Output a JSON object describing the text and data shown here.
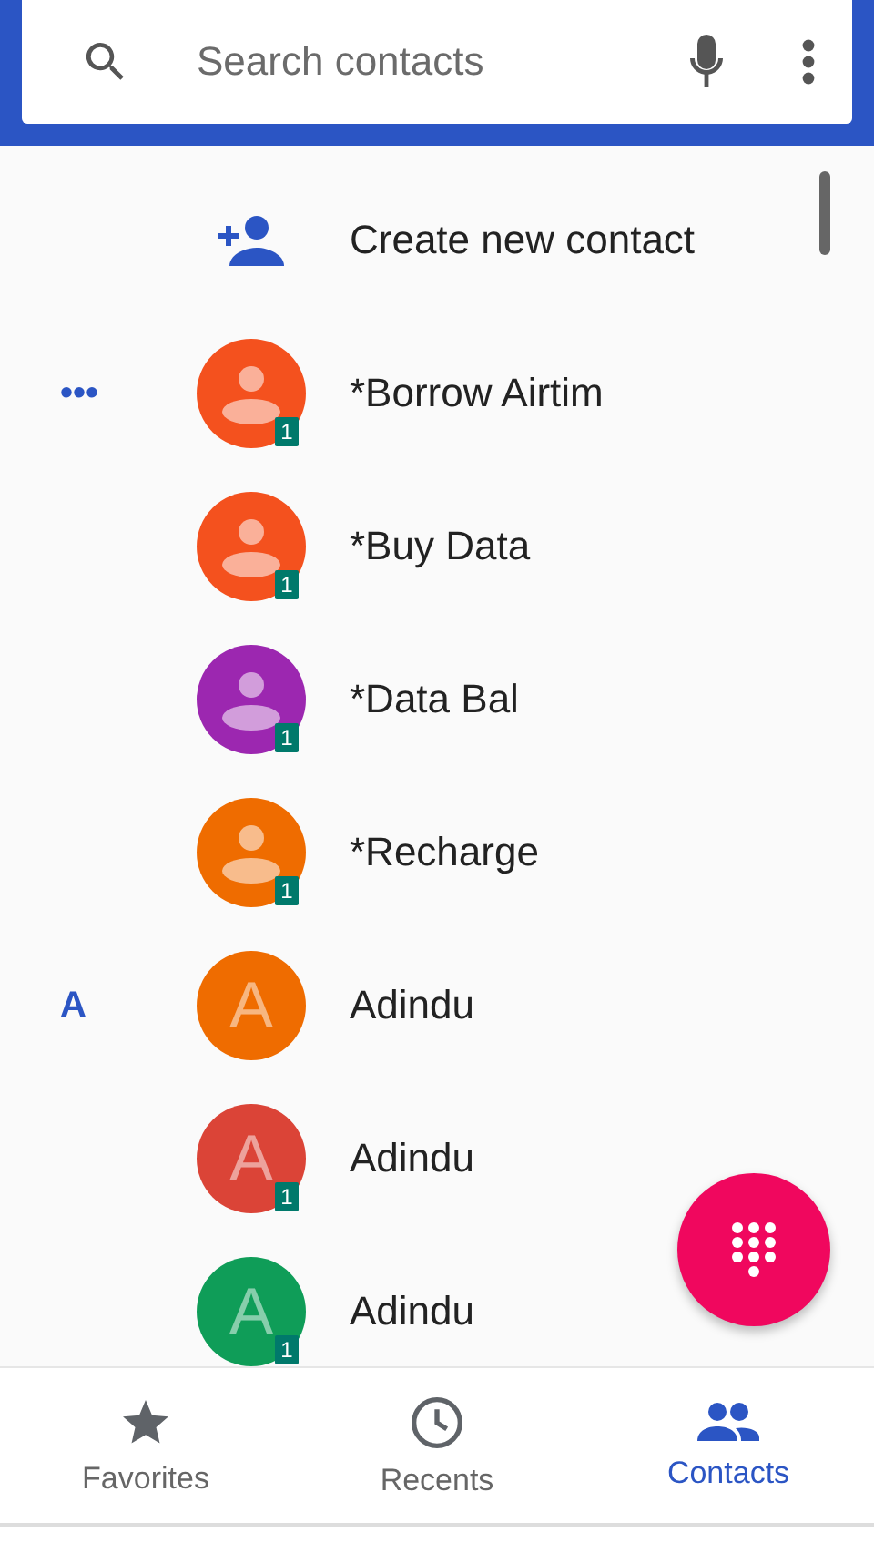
{
  "search": {
    "placeholder": "Search contacts"
  },
  "create_contact": {
    "label": "Create new contact"
  },
  "contacts": [
    {
      "section": "•••",
      "name": "*Borrow Airtim",
      "avatar": {
        "kind": "person",
        "color": "#f4511e"
      },
      "badge": "1"
    },
    {
      "name": "*Buy Data",
      "avatar": {
        "kind": "person",
        "color": "#f4511e"
      },
      "badge": "1"
    },
    {
      "name": "*Data Bal",
      "avatar": {
        "kind": "person",
        "color": "#9c27b0"
      },
      "badge": "1"
    },
    {
      "name": "*Recharge",
      "avatar": {
        "kind": "person",
        "color": "#ef6c00"
      },
      "badge": "1"
    },
    {
      "section": "A",
      "name": "Adindu",
      "avatar": {
        "kind": "letter",
        "letter": "A",
        "color": "#ef6c00"
      }
    },
    {
      "name": "Adindu",
      "avatar": {
        "kind": "letter",
        "letter": "A",
        "color": "#db4437"
      },
      "badge": "1"
    },
    {
      "name": "Adindu",
      "avatar": {
        "kind": "letter",
        "letter": "A",
        "color": "#0f9d58"
      },
      "badge": "1"
    }
  ],
  "bottom_nav": [
    {
      "label": "Favorites",
      "kind": "star",
      "selected": false
    },
    {
      "label": "Recents",
      "kind": "clock",
      "selected": false
    },
    {
      "label": "Contacts",
      "kind": "people",
      "selected": true
    }
  ]
}
